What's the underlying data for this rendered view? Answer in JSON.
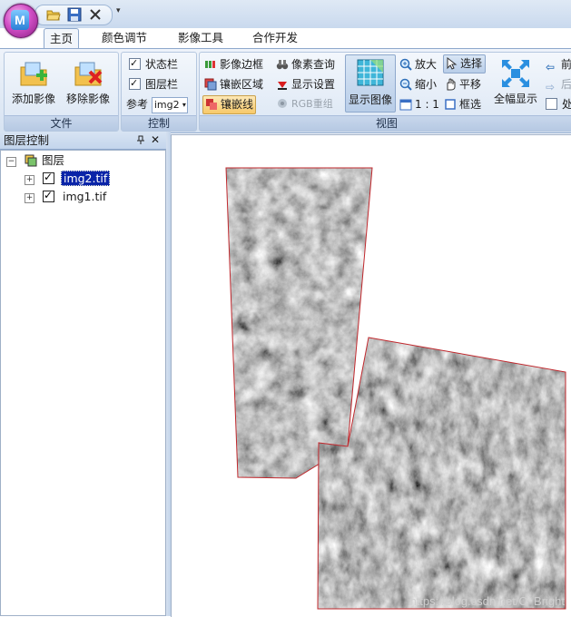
{
  "ribbon_tabs": [
    "主页",
    "颜色调节",
    "影像工具",
    "合作开发"
  ],
  "groups": {
    "file": {
      "label": "文件",
      "add_image": "添加影像",
      "remove_image": "移除影像"
    },
    "control": {
      "label": "控制",
      "status_bar": "状态栏",
      "layer_bar": "图层栏",
      "status_bar_checked": true,
      "layer_bar_checked": true,
      "reference_label": "参考",
      "reference_value": "img2"
    },
    "view": {
      "label": "视图",
      "image_border": "影像边框",
      "pixel_query": "像素查询",
      "mosaic_area": "镶嵌区域",
      "display_settings": "显示设置",
      "seamline": "镶嵌线",
      "rgb_recombine": "RGB重组",
      "show_image": "显示图像",
      "zoom_in": "放大",
      "zoom_out": "缩小",
      "ratio": "1 : 1",
      "select": "选择",
      "pan": "平移",
      "box_select": "框选",
      "full_extent": "全幅显示",
      "forward": "前",
      "back": "后",
      "process": "处"
    }
  },
  "layer_panel": {
    "title": "图层控制",
    "pin_icon": "ф",
    "close_icon": "✕",
    "root": "图层",
    "layers": [
      {
        "name": "img2.tif",
        "checked": true,
        "selected": true
      },
      {
        "name": "img1.tif",
        "checked": true,
        "selected": false
      }
    ]
  },
  "map": {
    "watermark": "https://blog.csdn.net/C_Bright",
    "footprint_color": "#c0282d",
    "background": "#ffffff"
  }
}
